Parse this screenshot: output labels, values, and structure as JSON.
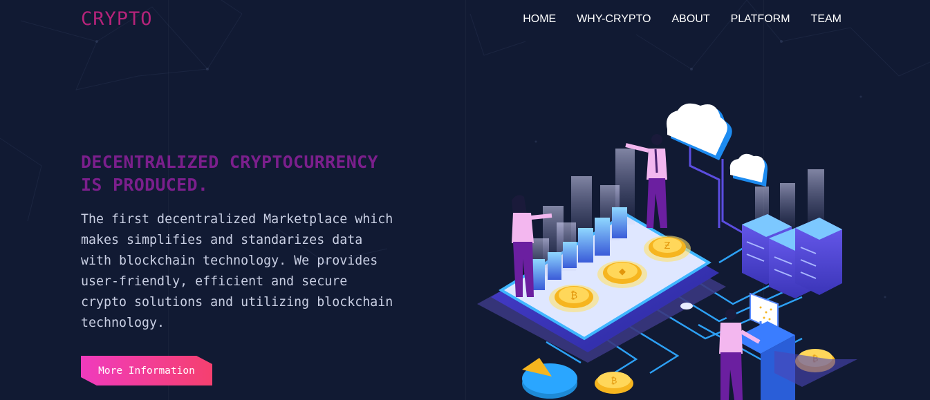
{
  "header": {
    "brand": "CRYPTO",
    "nav": [
      "HOME",
      "WHY-CRYPTO",
      "ABOUT",
      "PLATFORM",
      "TEAM"
    ]
  },
  "hero": {
    "headline_line1": "DECENTRALIZED CRYPTOCURRENCY",
    "headline_line2": "IS PRODUCED.",
    "description": [
      "The first decentralized Marketplace which",
      "makes simplifies and standarizes data",
      "with blockchain technology. We provides",
      "user-friendly, efficient and secure",
      "crypto solutions and utilizing blockchain",
      "technology."
    ],
    "cta_label": "More Information"
  },
  "colors": {
    "background": "#111a33",
    "brand": "#b5237a",
    "headline": "#7b1f8c",
    "cta_gradient_start": "#f03bbd",
    "cta_gradient_end": "#f5406f"
  },
  "illustration": {
    "icons": [
      "cloud-icon",
      "bitcoin-coin-icon",
      "ethereum-coin-icon",
      "server-rack-icon",
      "bar-chart-icon",
      "pie-chart-icon",
      "person-icon",
      "monitor-icon"
    ]
  }
}
